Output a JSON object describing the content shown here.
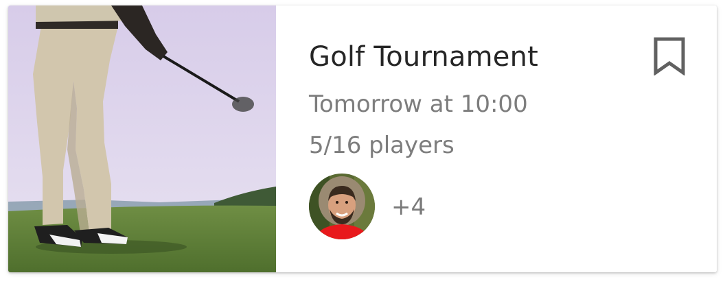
{
  "event": {
    "title": "Golf Tournament",
    "time": "Tomorrow at 10:00",
    "players": "5/16 players",
    "extra_players": "+4",
    "photo_icon": "golfer-swing-photo",
    "avatar_icon": "player-avatar",
    "bookmark_icon": "bookmark-outline-icon"
  },
  "colors": {
    "title": "#262626",
    "secondary_text": "#7d7d7d",
    "sky": "#ddd3ee",
    "grass": "#5f7f3a",
    "avatar_shirt": "#e8191c"
  }
}
